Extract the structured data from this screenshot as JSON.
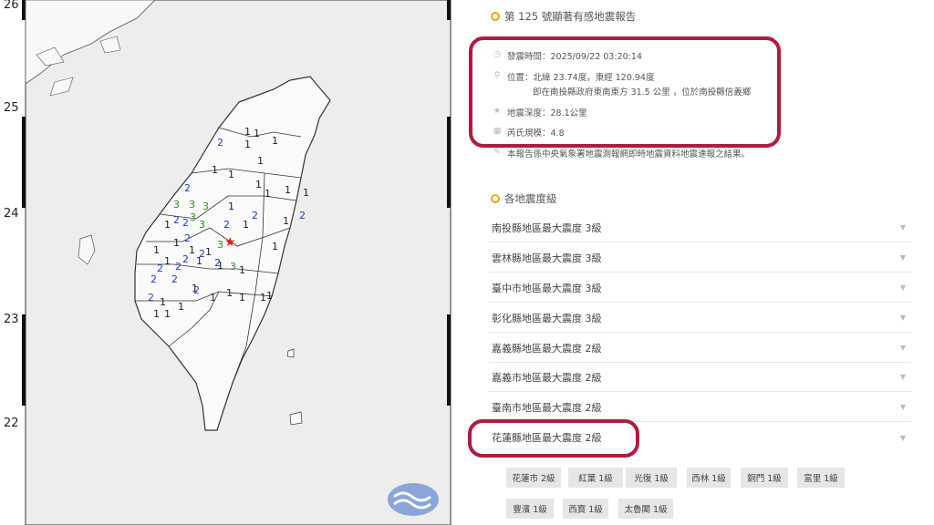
{
  "map": {
    "lat_labels": [
      "26",
      "25",
      "24",
      "23",
      "22"
    ],
    "epicenter_symbol": "★",
    "logo_icon": "cwa-logo-icon"
  },
  "report": {
    "title": "第 125 號顯著有感地震報告",
    "time": "發震時間：2025/09/22 03:20:14",
    "location": "位置：北緯 23.74度，東經 120.94度",
    "location_detail": "即在南投縣政府東南東方 31.5 公里 ，位於南投縣信義鄉",
    "depth": "地震深度：28.1公里",
    "magnitude": "芮氏規模：4.8",
    "note": "本報告係中央氣象署地震測報網即時地震資料地震速報之結果。"
  },
  "intensity_section": {
    "title": "各地震度級",
    "regions": [
      "南投縣地區最大震度 3級",
      "雲林縣地區最大震度 3級",
      "臺中市地區最大震度 3級",
      "彰化縣地區最大震度 3級",
      "嘉義縣地區最大震度 2級",
      "嘉義市地區最大震度 2級",
      "臺南市地區最大震度 2級",
      "花蓮縣地區最大震度 2級"
    ],
    "chips": [
      "花蓮市 2級",
      "紅葉 1級",
      "光復 1級",
      "西林 1級",
      "銅門 1級",
      "富里 1級",
      "豐濱 1級",
      "西寶 1級",
      "太魯閣 1級"
    ]
  },
  "colors": {
    "accent_red": "#b01b3f",
    "dot_orange": "#f0a020",
    "level3": "#2e8b2e",
    "level2": "#1a3fd0",
    "level1": "#222222"
  }
}
